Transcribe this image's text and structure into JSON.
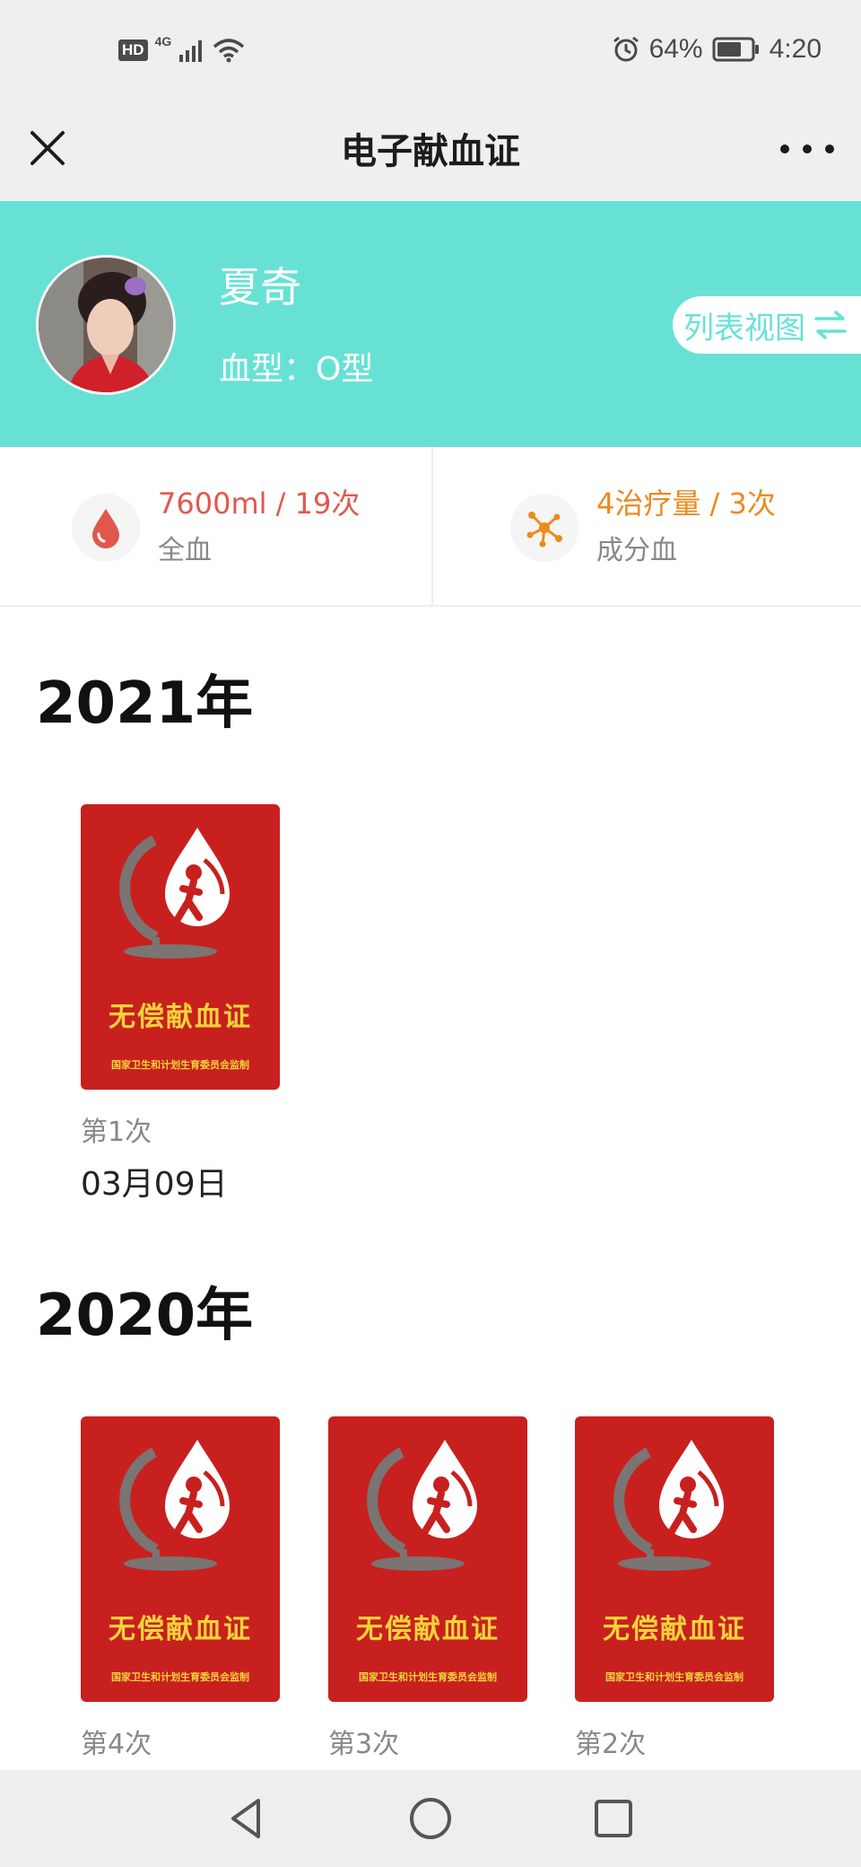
{
  "status_bar": {
    "hd": "HD",
    "network": "4G",
    "battery": "64%",
    "time": "4:20"
  },
  "header": {
    "title": "电子献血证"
  },
  "profile": {
    "name": "夏奇",
    "blood_type": "血型：O型",
    "view_toggle_label": "列表视图"
  },
  "stats": {
    "whole_blood": {
      "value": "7600ml / 19次",
      "label": "全血"
    },
    "component_blood": {
      "value": "4治疗量 / 3次",
      "label": "成分血"
    }
  },
  "certificate": {
    "title": "无偿献血证",
    "subtitle": "国家卫生和计划生育委员会监制"
  },
  "years": [
    {
      "year": "2021年",
      "cards": [
        {
          "count": "第1次",
          "date": "03月09日"
        }
      ]
    },
    {
      "year": "2020年",
      "cards": [
        {
          "count": "第4次"
        },
        {
          "count": "第3次"
        },
        {
          "count": "第2次"
        }
      ]
    }
  ],
  "colors": {
    "accent_teal": "#68e1d5",
    "whole_blood_red": "#e2574c",
    "component_orange": "#ec8a1c",
    "certificate_red": "#c8201f",
    "certificate_gold": "#f2d33a"
  }
}
